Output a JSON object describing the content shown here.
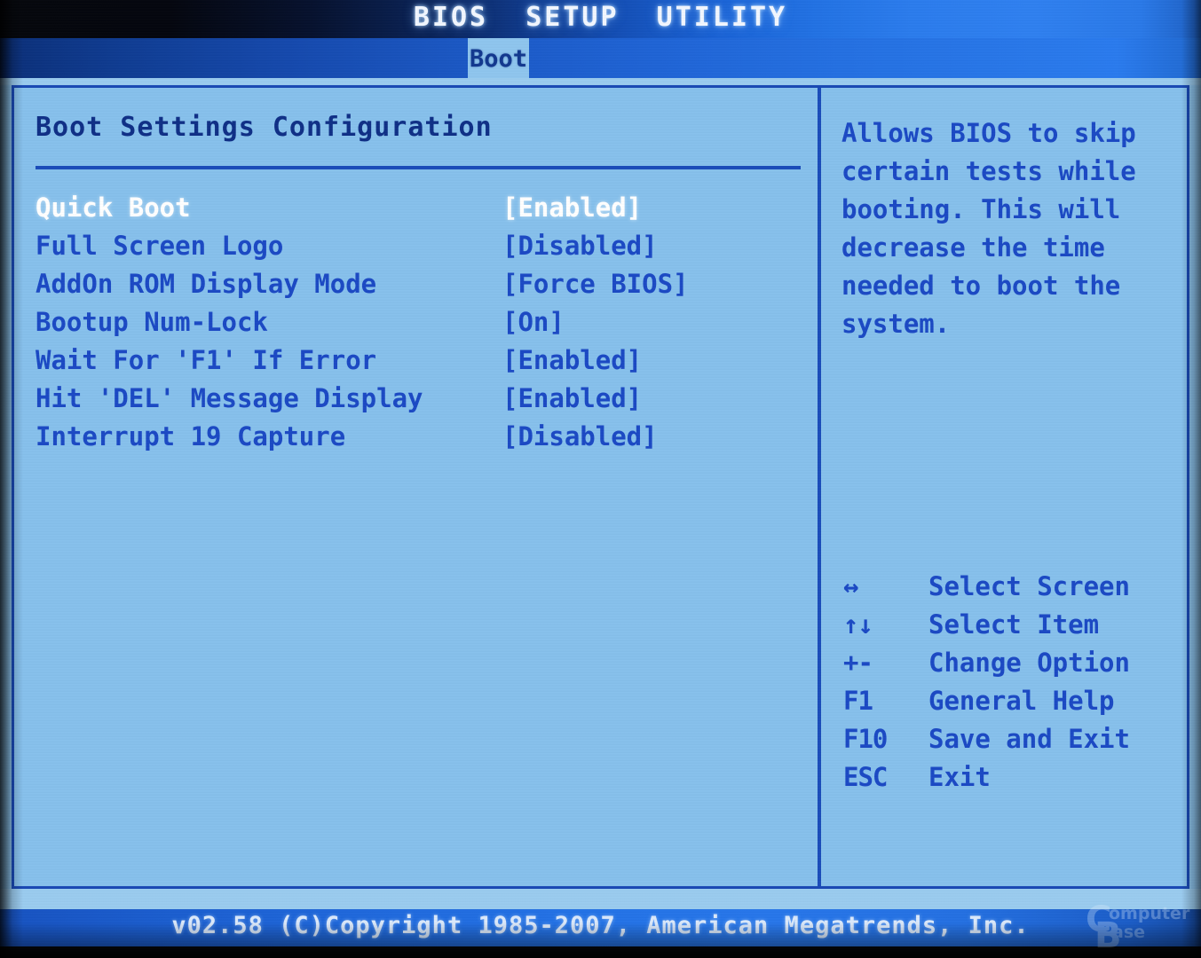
{
  "header": {
    "title": "BIOS  SETUP  UTILITY",
    "active_tab": "Boot",
    "tabs": [
      "Boot"
    ]
  },
  "main": {
    "section_title": "Boot Settings Configuration",
    "settings": [
      {
        "label": "Quick Boot",
        "value": "[Enabled]",
        "selected": true
      },
      {
        "label": "Full Screen Logo",
        "value": "[Disabled]",
        "selected": false
      },
      {
        "label": "AddOn ROM Display Mode",
        "value": "[Force BIOS]",
        "selected": false
      },
      {
        "label": "Bootup Num-Lock",
        "value": "[On]",
        "selected": false
      },
      {
        "label": "Wait For 'F1' If Error",
        "value": "[Enabled]",
        "selected": false
      },
      {
        "label": "Hit 'DEL' Message Display",
        "value": "[Enabled]",
        "selected": false
      },
      {
        "label": "Interrupt 19 Capture",
        "value": "[Disabled]",
        "selected": false
      }
    ]
  },
  "help": {
    "text": "Allows BIOS to skip\ncertain tests while\nbooting. This will\ndecrease the time\nneeded to boot the\nsystem.",
    "legend": [
      {
        "key": "↔",
        "label": "Select Screen"
      },
      {
        "key": "↑↓",
        "label": "Select Item"
      },
      {
        "key": "+-",
        "label": "Change Option"
      },
      {
        "key": "F1",
        "label": "General Help"
      },
      {
        "key": "F10",
        "label": "Save and Exit"
      },
      {
        "key": "ESC",
        "label": "Exit"
      }
    ]
  },
  "footer": {
    "text": "v02.58 (C)Copyright 1985-2007, American Megatrends, Inc."
  },
  "watermark": {
    "line1": "omputer",
    "line2": "ase",
    "big_c": "C",
    "big_b": "B"
  },
  "colors": {
    "screen_bg": "#86C0EC",
    "text_blue": "#1b49c4",
    "title_navy": "#0f2f86",
    "selected_white": "#ffffff",
    "border_blue": "#1848b4",
    "tab_active_bg": "#8FC5EE",
    "footer_text": "#dbe9fb"
  }
}
